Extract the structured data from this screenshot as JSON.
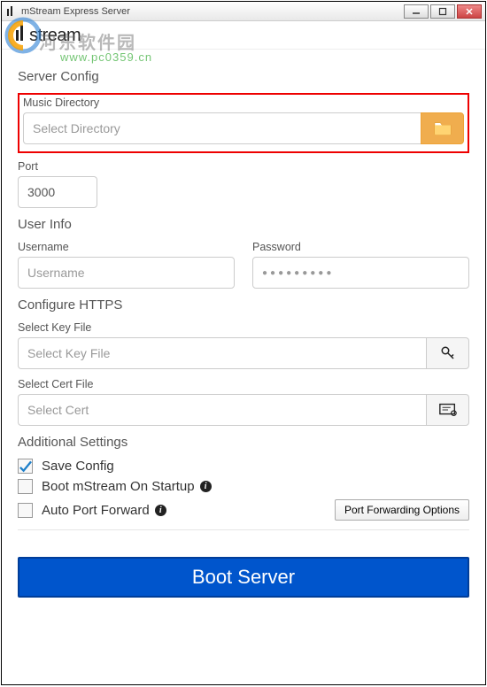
{
  "window": {
    "title": "mStream Express Server",
    "brand": "stream"
  },
  "watermark": {
    "cn": "河东软件园",
    "url": "www.pc0359.cn"
  },
  "sections": {
    "server_config": "Server Config",
    "user_info": "User Info",
    "configure_https": "Configure HTTPS",
    "additional_settings": "Additional Settings"
  },
  "fields": {
    "music_directory_label": "Music Directory",
    "music_directory_placeholder": "Select Directory",
    "port_label": "Port",
    "port_value": "3000",
    "username_label": "Username",
    "username_placeholder": "Username",
    "password_label": "Password",
    "password_placeholder": "●●●●●●●●●",
    "key_file_label": "Select Key File",
    "key_file_placeholder": "Select Key File",
    "cert_file_label": "Select Cert File",
    "cert_file_placeholder": "Select Cert"
  },
  "checkboxes": {
    "save_config": "Save Config",
    "boot_startup": "Boot mStream On Startup",
    "auto_port_forward": "Auto Port Forward"
  },
  "buttons": {
    "port_forwarding_options": "Port Forwarding Options",
    "boot_server": "Boot Server"
  }
}
